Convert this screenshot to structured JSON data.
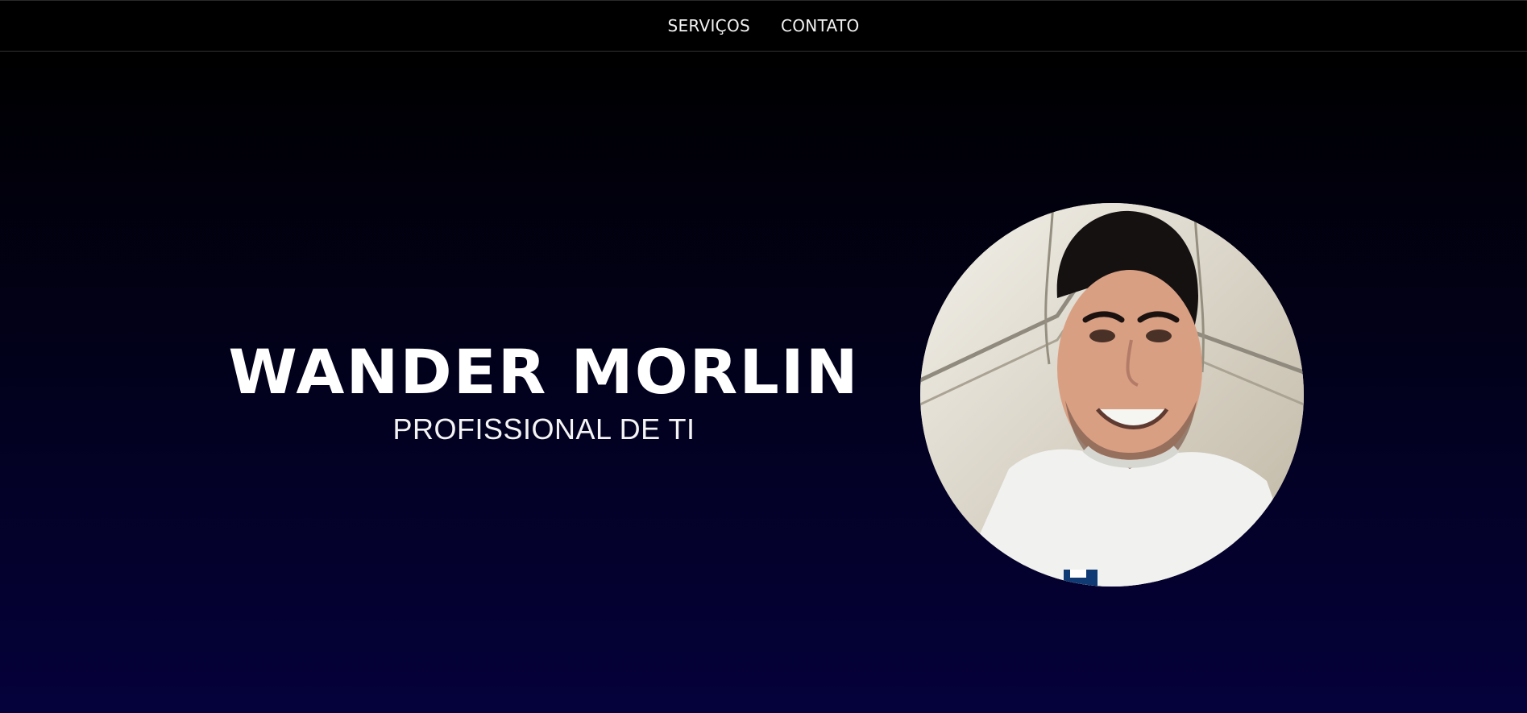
{
  "nav": {
    "items": [
      {
        "label": "SERVIÇOS"
      },
      {
        "label": "CONTATO"
      }
    ]
  },
  "hero": {
    "name": "WANDER MORLIN",
    "role": "PROFISSIONAL DE TI"
  },
  "colors": {
    "nav_bg": "#000000",
    "hero_top": "#000000",
    "hero_bottom": "#05013b",
    "text": "#ffffff"
  },
  "icons": {
    "profile": "profile-photo-icon"
  }
}
